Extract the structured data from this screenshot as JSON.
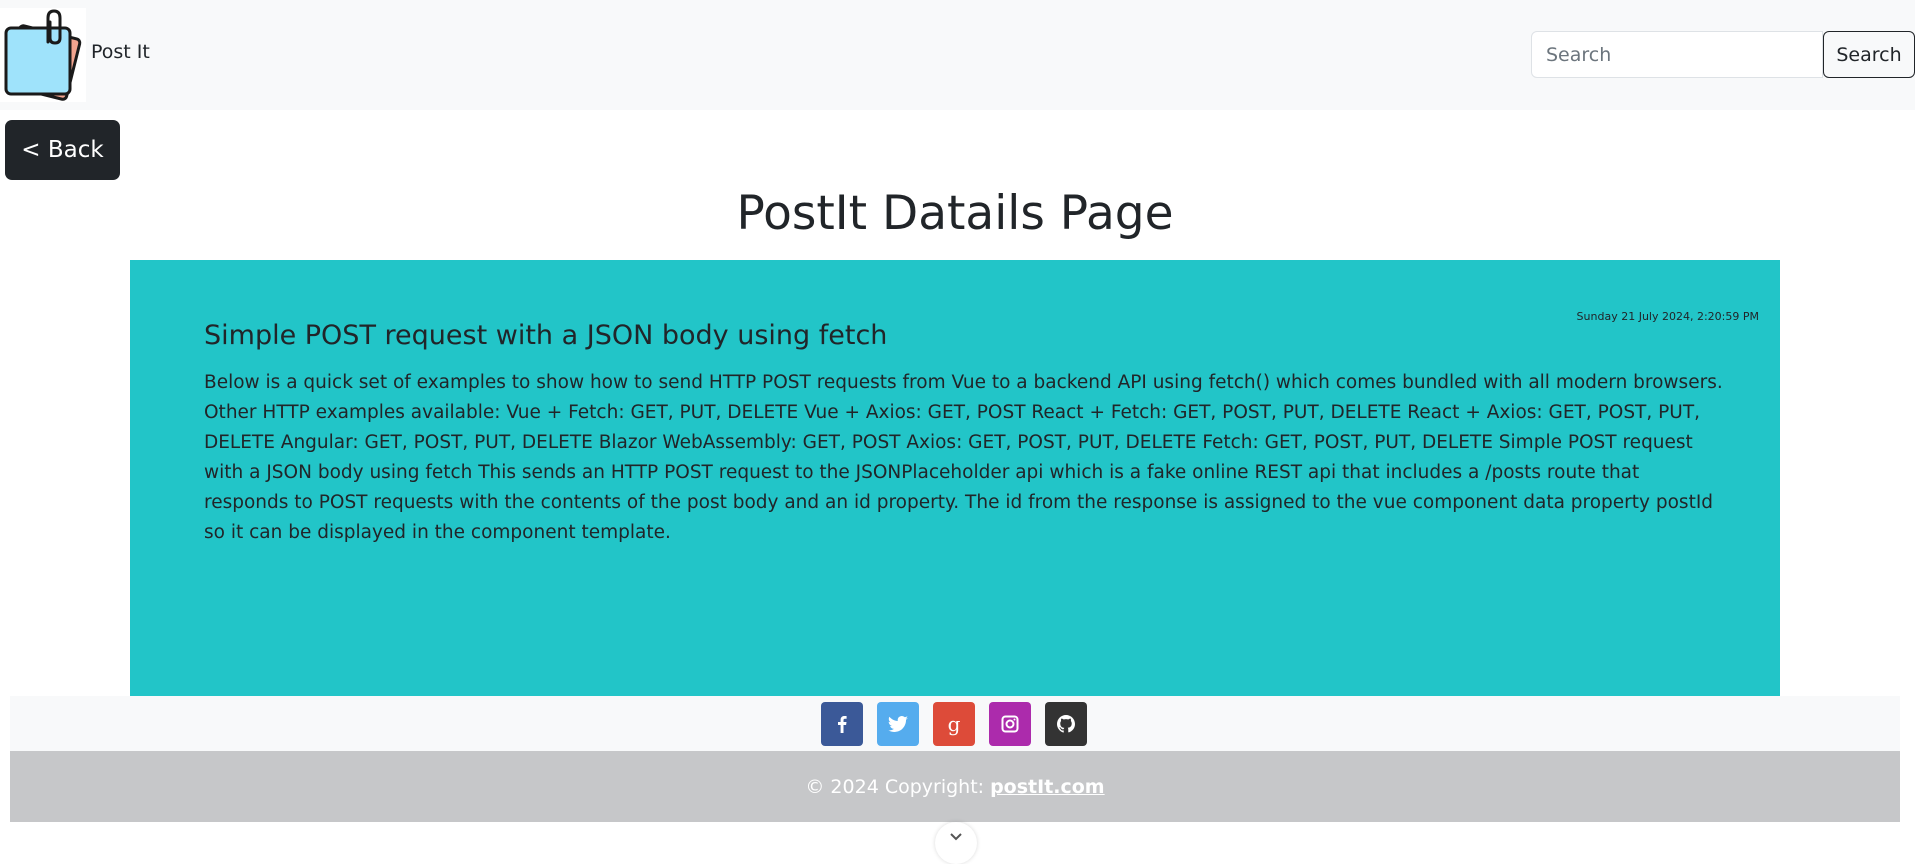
{
  "navbar": {
    "brand_name": "Post It",
    "search_placeholder": "Search",
    "search_button": "Search"
  },
  "back_button": "< Back",
  "page_title": "PostIt Datails Page",
  "post": {
    "date": "Sunday 21 July 2024, 2:20:59 PM",
    "title": "Simple POST request with a JSON body using fetch",
    "body": "Below is a quick set of examples to show how to send HTTP POST requests from Vue to a backend API using fetch() which comes bundled with all modern browsers. Other HTTP examples available: Vue + Fetch: GET, PUT, DELETE Vue + Axios: GET, POST React + Fetch: GET, POST, PUT, DELETE React + Axios: GET, POST, PUT, DELETE Angular: GET, POST, PUT, DELETE Blazor WebAssembly: GET, POST Axios: GET, POST, PUT, DELETE Fetch: GET, POST, PUT, DELETE Simple POST request with a JSON body using fetch This sends an HTTP POST request to the JSONPlaceholder api which is a fake online REST api that includes a /posts route that responds to POST requests with the contents of the post body and an id property. The id from the response is assigned to the vue component data property postId so it can be displayed in the component template."
  },
  "social": [
    {
      "name": "facebook",
      "color": "#3b5998",
      "icon": "facebook-icon",
      "glyph": "f"
    },
    {
      "name": "twitter",
      "color": "#55acee",
      "icon": "twitter-icon",
      "glyph": ""
    },
    {
      "name": "google",
      "color": "#dd4b39",
      "icon": "google-icon",
      "glyph": "g"
    },
    {
      "name": "instagram",
      "color": "#ac2bac",
      "icon": "instagram-icon",
      "glyph": ""
    },
    {
      "name": "github",
      "color": "#333333",
      "icon": "github-icon",
      "glyph": ""
    }
  ],
  "footer": {
    "copyright": "© 2024 Copyright:",
    "link": "postIt.com"
  },
  "colors": {
    "card": "#22c5c8",
    "navbar": "#f8f9fa",
    "footer": "#c6c7c9",
    "dark": "#212529"
  }
}
